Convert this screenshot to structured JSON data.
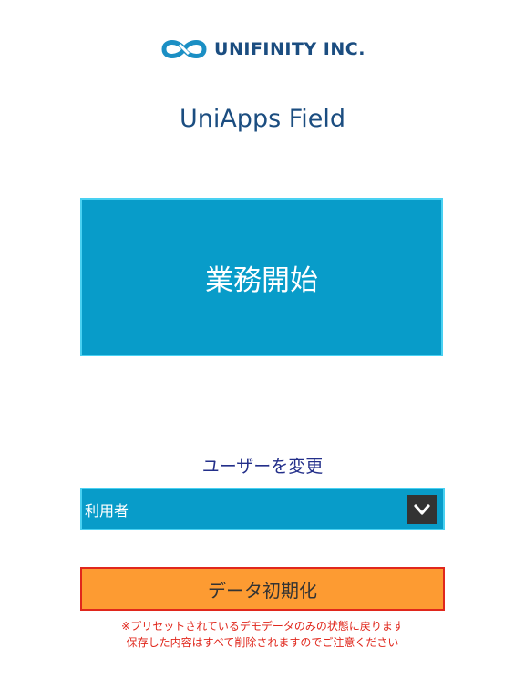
{
  "logo": {
    "text": "UNIFINITY INC.",
    "icon": "infinity-logo-icon",
    "color": "#1b8fc4"
  },
  "app_title": "UniApps Field",
  "start_button": {
    "label": "業務開始",
    "color": "#089cc9"
  },
  "change_user": {
    "label": "ユーザーを変更",
    "selected_value": "利用者",
    "dropdown_icon": "chevron-down-icon"
  },
  "reset_button": {
    "label": "データ初期化",
    "color": "#fd9b32",
    "border_color": "#e0271c"
  },
  "notice": {
    "line1": "※プリセットされているデモデータのみの状態に戻ります",
    "line2": "保存した内容はすべて削除されますのでご注意ください",
    "color": "#e0271c"
  }
}
